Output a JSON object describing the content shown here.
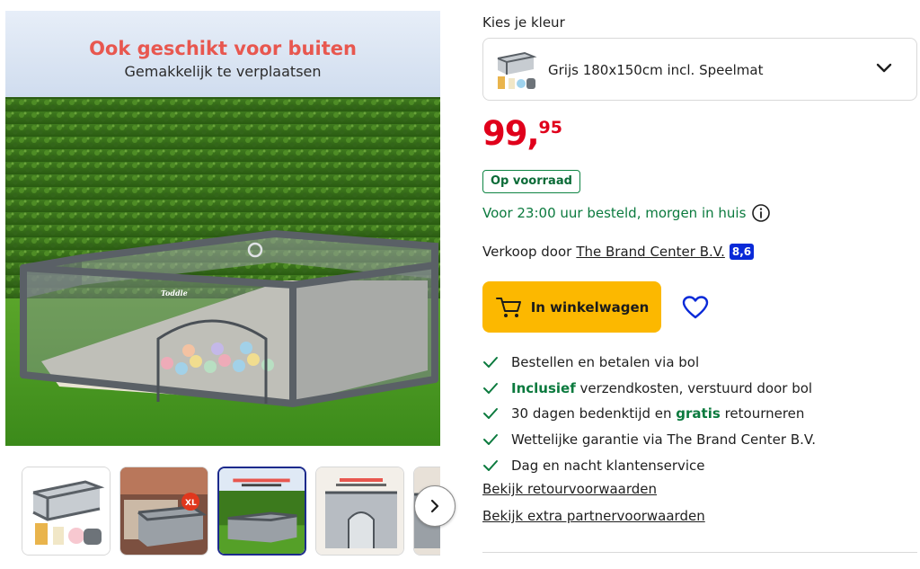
{
  "gallery": {
    "promo_title": "Ook geschikt voor buiten",
    "promo_subtitle": "Gemakkelijk te verplaatsen",
    "brand_stamp": "Toddle",
    "thumbnails": [
      {
        "icon": "playpen-product-thumbnail"
      },
      {
        "icon": "playpen-room-thumbnail",
        "badge": "XL"
      },
      {
        "icon": "playpen-outdoor-thumbnail",
        "active": true
      },
      {
        "icon": "playpen-detail-thumbnail"
      },
      {
        "icon": "playpen-partial-thumbnail"
      }
    ],
    "next_icon": "chevron-right-icon"
  },
  "variant": {
    "label": "Kies je kleur",
    "selected": "Grijs 180x150cm incl. Speelmat",
    "chevron_icon": "chevron-down-icon"
  },
  "price": {
    "euros": "99,",
    "cents": "95",
    "color": "#e0001b"
  },
  "stock": {
    "badge": "Op voorraad",
    "delivery": "Voor 23:00 uur besteld, morgen in huis",
    "info_icon": "info-icon"
  },
  "seller": {
    "prefix": "Verkoop door",
    "name": "The Brand Center B.V.",
    "score": "8,6"
  },
  "actions": {
    "cart_label": "In winkelwagen",
    "cart_icon": "cart-icon",
    "wishlist_icon": "heart-icon",
    "accent": "#fcb800"
  },
  "usps": [
    {
      "pre": "",
      "bold": "",
      "post": "Bestellen en betalen via bol"
    },
    {
      "pre": "",
      "bold": "Inclusief",
      "post": " verzendkosten, verstuurd door bol"
    },
    {
      "pre": "30 dagen bedenktijd en ",
      "bold": "gratis",
      "post": " retourneren"
    },
    {
      "pre": "",
      "bold": "",
      "post": "Wettelijke garantie via The Brand Center B.V."
    },
    {
      "pre": "",
      "bold": "",
      "post": "Dag en nacht klantenservice"
    }
  ],
  "links": {
    "returns": "Bekijk retourvoorwaarden",
    "partner": "Bekijk extra partnervoorwaarden"
  }
}
